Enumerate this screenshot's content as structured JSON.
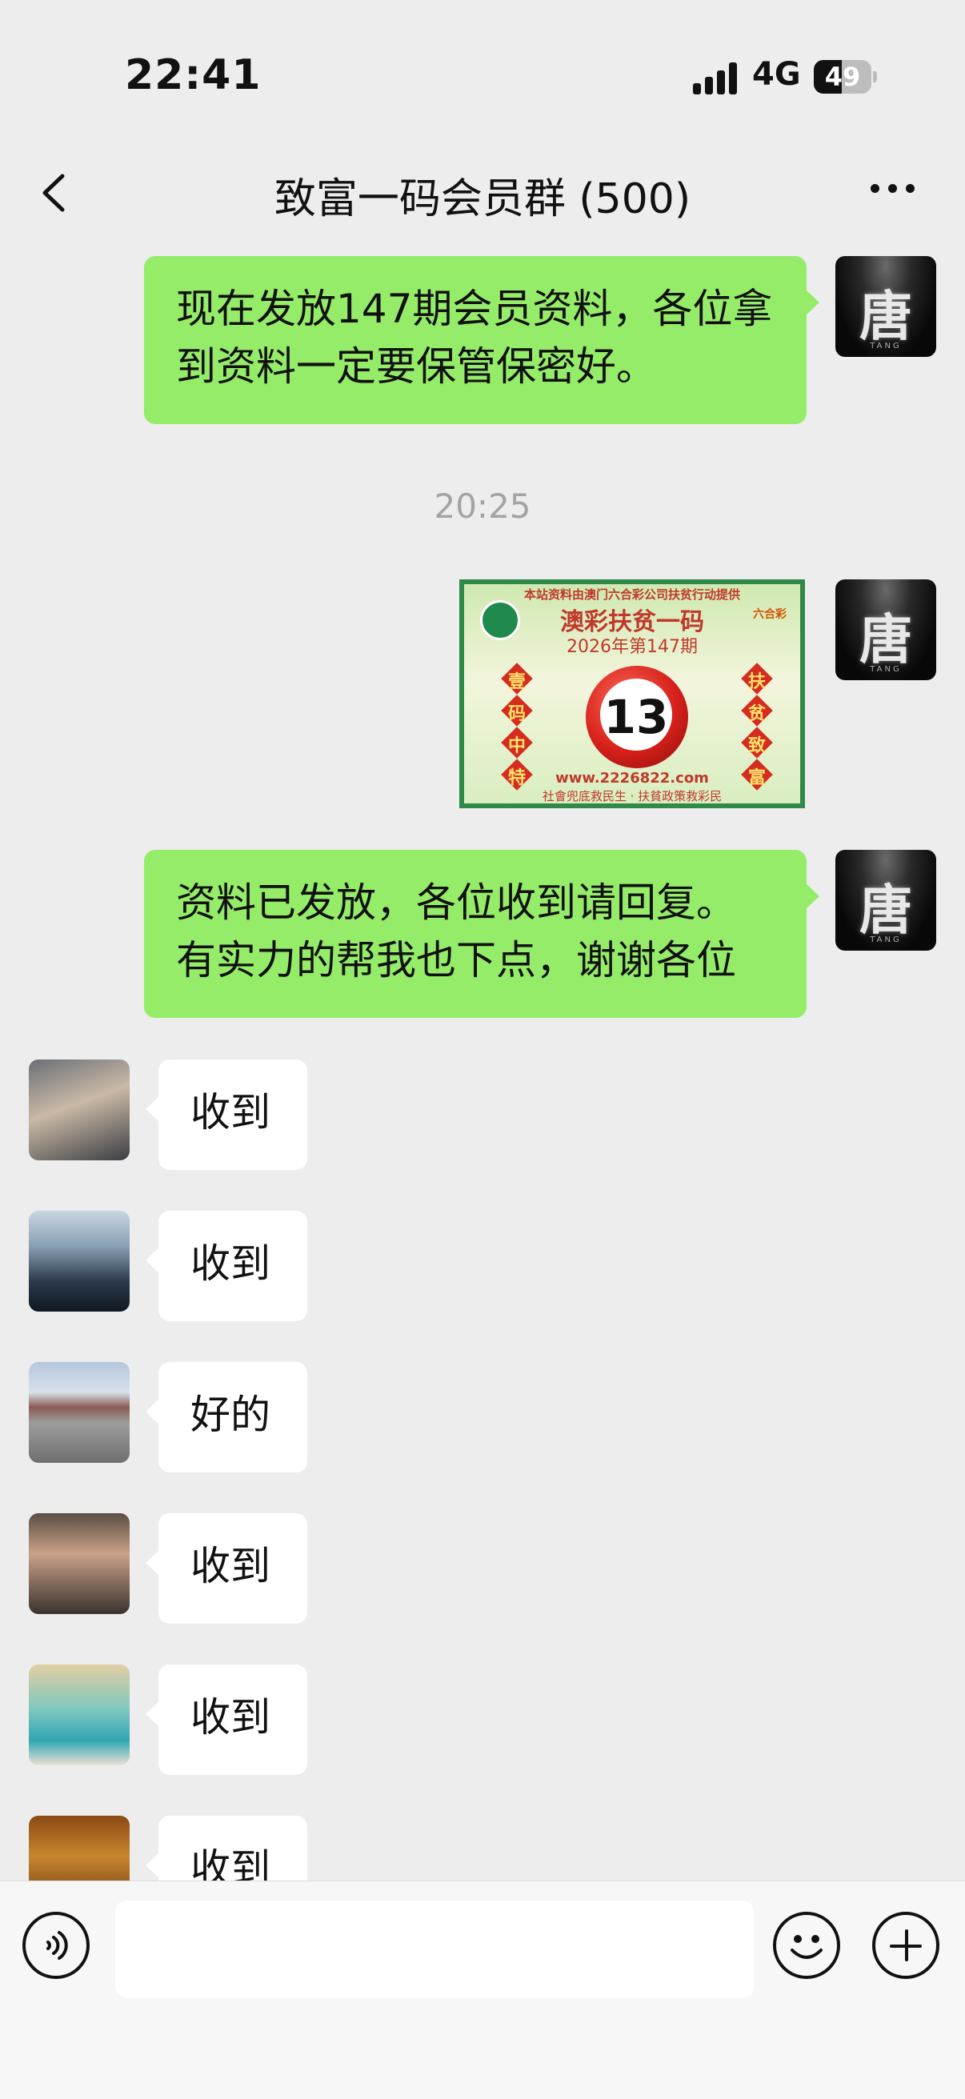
{
  "status_bar": {
    "time": "22:41",
    "network": "4G",
    "battery": "49",
    "battery_level": 0.49
  },
  "nav": {
    "title": "致富一码会员群 (500)"
  },
  "messages": [
    {
      "from": "me",
      "avatar_text": "唐",
      "avatar_sub": "TANG",
      "text": "现在发放147期会员资料，各位拿到资料一定要保管保密好。"
    },
    {
      "type": "timestamp",
      "text": "20:25"
    },
    {
      "from": "me",
      "avatar_text": "唐",
      "avatar_sub": "TANG",
      "type": "image",
      "image": {
        "top_line": "本站资料由澳门六合彩公司扶贫行动提供",
        "title": "澳彩扶贫一码",
        "issue": "2026年第147期",
        "logo": "六合彩",
        "left_chars": [
          "壹",
          "码",
          "中",
          "特"
        ],
        "right_chars": [
          "扶",
          "贫",
          "致",
          "富"
        ],
        "number": "13",
        "url": "www.2226822.com",
        "slogan": "社會兜底救民生 · 扶貧政策救彩民"
      }
    },
    {
      "from": "me",
      "avatar_text": "唐",
      "avatar_sub": "TANG",
      "text": "资料已发放，各位收到请回复。有实力的帮我也下点，谢谢各位"
    },
    {
      "from": "other",
      "text": "收到"
    },
    {
      "from": "other",
      "text": "收到"
    },
    {
      "from": "other",
      "text": "好的"
    },
    {
      "from": "other",
      "text": "收到"
    },
    {
      "from": "other",
      "text": "收到"
    },
    {
      "from": "other",
      "text": "收到"
    }
  ],
  "input_bar": {
    "placeholder": ""
  },
  "icons": [
    "back-arrow-icon",
    "more-icon",
    "voice-icon",
    "emoji-icon",
    "plus-icon",
    "signal-icon",
    "battery-icon"
  ]
}
